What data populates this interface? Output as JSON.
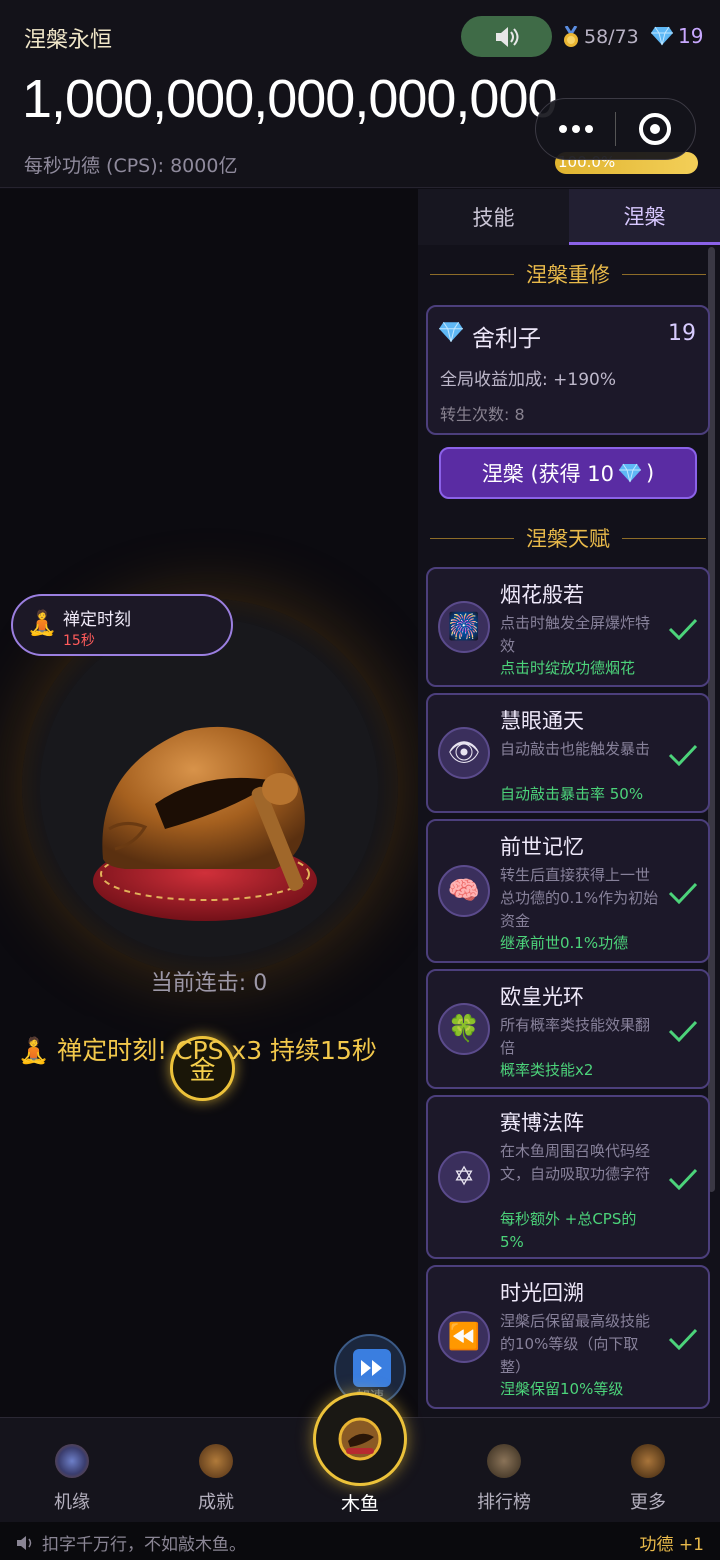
{
  "header": {
    "app_title": "涅槃永恒",
    "medal_count": "58/73",
    "gem_count": "19",
    "merit_total": "1,000,000,000,000,000",
    "cps_text": "每秒功德 (CPS): 8000亿",
    "progress_label": "100.0%",
    "progress_value": 1.0
  },
  "left": {
    "zen_badge_name": "禅定时刻",
    "zen_badge_time": "15秒",
    "combo_text": "当前连击: 0",
    "coin_label": "金",
    "zen_banner": "禅定时刻! CPS x3 持续15秒",
    "speed_label": "加速"
  },
  "right": {
    "tabs": [
      {
        "label": "技能",
        "active": false
      },
      {
        "label": "涅槃",
        "active": true
      }
    ],
    "rebirth_section": "涅槃重修",
    "relic": {
      "name": "舍利子",
      "count": "19",
      "bonus": "全局收益加成: +190%",
      "rebirths": "转生次数: 8"
    },
    "nirvana_button": "涅槃 (获得 10",
    "nirvana_button_close": ")",
    "talent_section": "涅槃天赋",
    "talents": [
      {
        "icon": "fireworks-icon",
        "glyph": "🎆",
        "title": "烟花般若",
        "desc": "点击时触发全屏爆炸特效",
        "effect": "点击时绽放功德烟花"
      },
      {
        "icon": "eye-icon",
        "glyph": "👁",
        "title": "慧眼通天",
        "desc": "自动敲击也能触发暴击",
        "effect": "自动敲击暴击率 50%"
      },
      {
        "icon": "brain-icon",
        "glyph": "🧠",
        "title": "前世记忆",
        "desc": "转生后直接获得上一世总功德的0.1%作为初始资金",
        "effect": "继承前世0.1%功德"
      },
      {
        "icon": "clover-icon",
        "glyph": "🍀",
        "title": "欧皇光环",
        "desc": "所有概率类技能效果翻倍",
        "effect": "概率类技能x2"
      },
      {
        "icon": "hexagram-icon",
        "glyph": "✡",
        "title": "赛博法阵",
        "desc": "在木鱼周围召唤代码经文，自动吸取功德字符",
        "effect": "每秒额外 +总CPS的5%"
      },
      {
        "icon": "rewind-icon",
        "glyph": "⏪",
        "title": "时光回溯",
        "desc": "涅槃后保留最高级技能的10%等级（向下取整）",
        "effect": "涅槃保留10%等级"
      }
    ]
  },
  "nav": {
    "items": [
      {
        "label": "机缘",
        "icon": "fortune-icon"
      },
      {
        "label": "成就",
        "icon": "achievement-icon"
      },
      {
        "label": "木鱼",
        "icon": "wooden-fish-icon"
      },
      {
        "label": "排行榜",
        "icon": "leaderboard-icon"
      },
      {
        "label": "更多",
        "icon": "more-icon"
      }
    ]
  },
  "footer": {
    "message": "扣字千万行，不如敲木鱼。",
    "merit_gain": "功德 +1"
  },
  "colors": {
    "accent_purple": "#8b62e8",
    "gold": "#ecc23a",
    "success_green": "#4cd37a"
  }
}
